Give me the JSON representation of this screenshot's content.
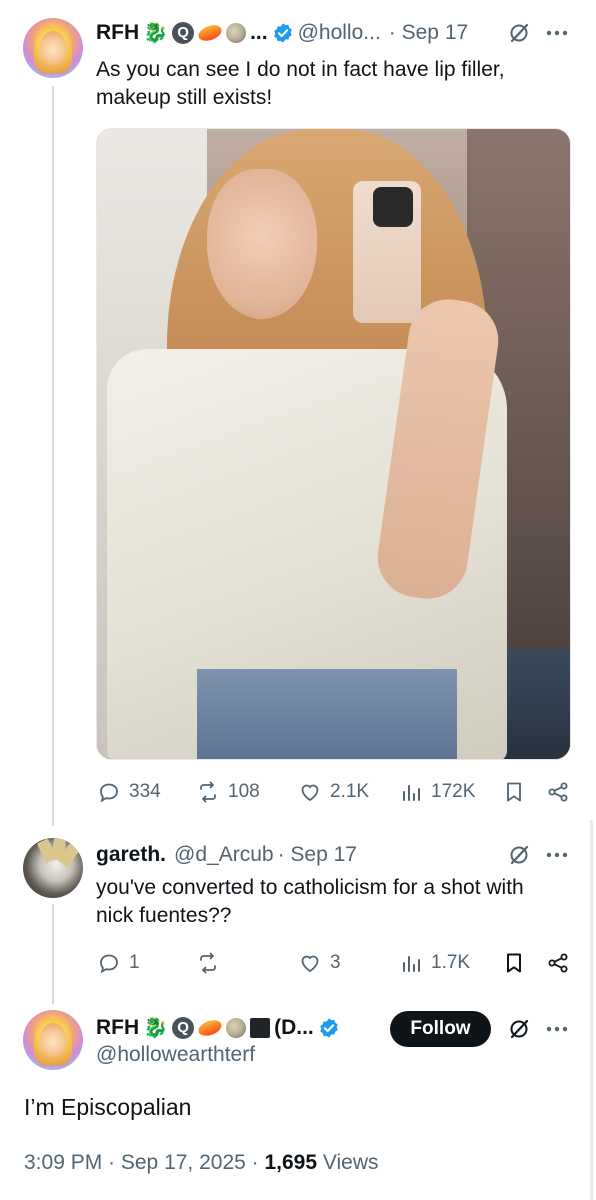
{
  "tweet1": {
    "display_name": "RFH",
    "name_ellipsis": "...",
    "handle": "@hollo...",
    "date": "· Sep 17",
    "text_line1": "As you can see I do not in fact have lip filler,",
    "text_line2": "makeup still exists!",
    "stats": {
      "replies": "334",
      "reposts": "108",
      "likes": "2.1K",
      "views": "172K"
    }
  },
  "reply": {
    "display_name": "gareth.",
    "handle": "@d_Arcub",
    "date": "· Sep 17",
    "text_line1": "you've converted to catholicism for a shot with",
    "text_line2": "nick fuentes??",
    "stats": {
      "replies": "1",
      "likes": "3",
      "views": "1.7K"
    }
  },
  "tweet2": {
    "display_name": "RFH",
    "name_suffix": "(D...",
    "handle": "@hollowearthterf",
    "follow_label": "Follow",
    "text": "I’m Episcopalian",
    "timestamp": "3:09 PM · Sep 17, 2025 · ",
    "views_count": "1,695",
    "views_label": " Views"
  },
  "colors": {
    "text": "#0f1419",
    "secondary": "#536471",
    "verified": "#1d9bf0",
    "thread_line": "#cfd9de"
  }
}
